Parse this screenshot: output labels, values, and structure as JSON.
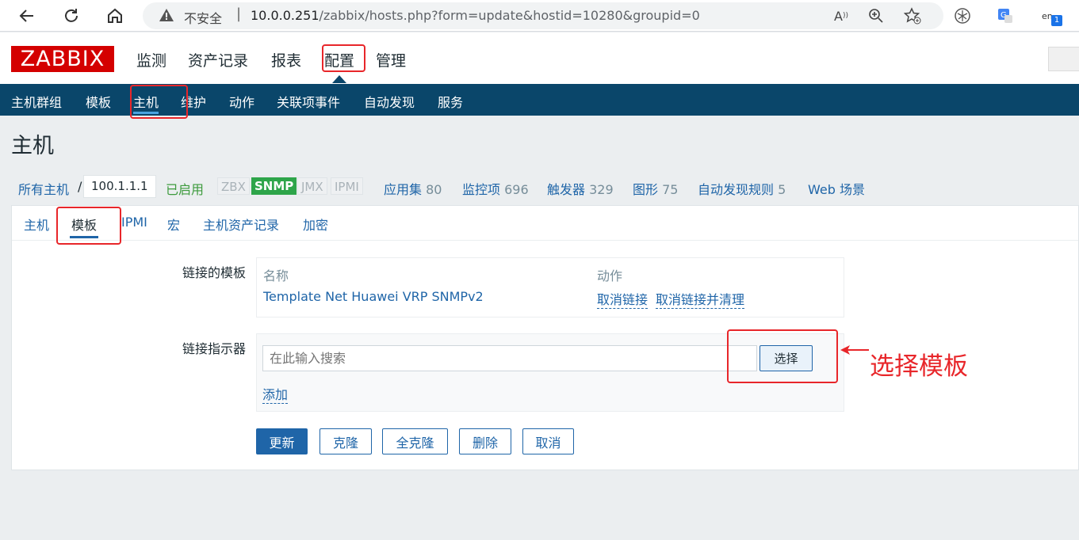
{
  "browser": {
    "insecure_label": "不安全",
    "url_host": "10.0.0.251",
    "url_path": "/zabbix/hosts.php?form=update&hostid=10280&groupid=0",
    "badge_count": "1",
    "lang_label": "en"
  },
  "header": {
    "logo": "ZABBIX",
    "menu": [
      "监测",
      "资产记录",
      "报表",
      "配置",
      "管理"
    ]
  },
  "subnav": {
    "items": [
      "主机群组",
      "模板",
      "主机",
      "维护",
      "动作",
      "关联项事件",
      "自动发现",
      "服务"
    ]
  },
  "page": {
    "title": "主机"
  },
  "hostnav": {
    "all_hosts": "所有主机",
    "separator": "/",
    "host": "100.1.1.1",
    "status": "已启用",
    "availability": [
      "ZBX",
      "SNMP",
      "JMX",
      "IPMI"
    ],
    "links": [
      {
        "label": "应用集",
        "count": "80"
      },
      {
        "label": "监控项",
        "count": "696"
      },
      {
        "label": "触发器",
        "count": "329"
      },
      {
        "label": "图形",
        "count": "75"
      },
      {
        "label": "自动发现规则",
        "count": "5"
      },
      {
        "label": "Web 场景",
        "count": ""
      }
    ]
  },
  "tabs": [
    "主机",
    "模板",
    "IPMI",
    "宏",
    "主机资产记录",
    "加密"
  ],
  "form": {
    "linked_label": "链接的模板",
    "col_name": "名称",
    "col_action": "动作",
    "template_name": "Template Net Huawei VRP SNMPv2",
    "unlink": "取消链接",
    "unlink_clear": "取消链接并清理",
    "indicator_label": "链接指示器",
    "search_placeholder": "在此输入搜索",
    "select_button": "选择",
    "add_link": "添加"
  },
  "buttons": [
    "更新",
    "克隆",
    "全克隆",
    "删除",
    "取消"
  ],
  "annotation": {
    "text": "选择模板"
  }
}
